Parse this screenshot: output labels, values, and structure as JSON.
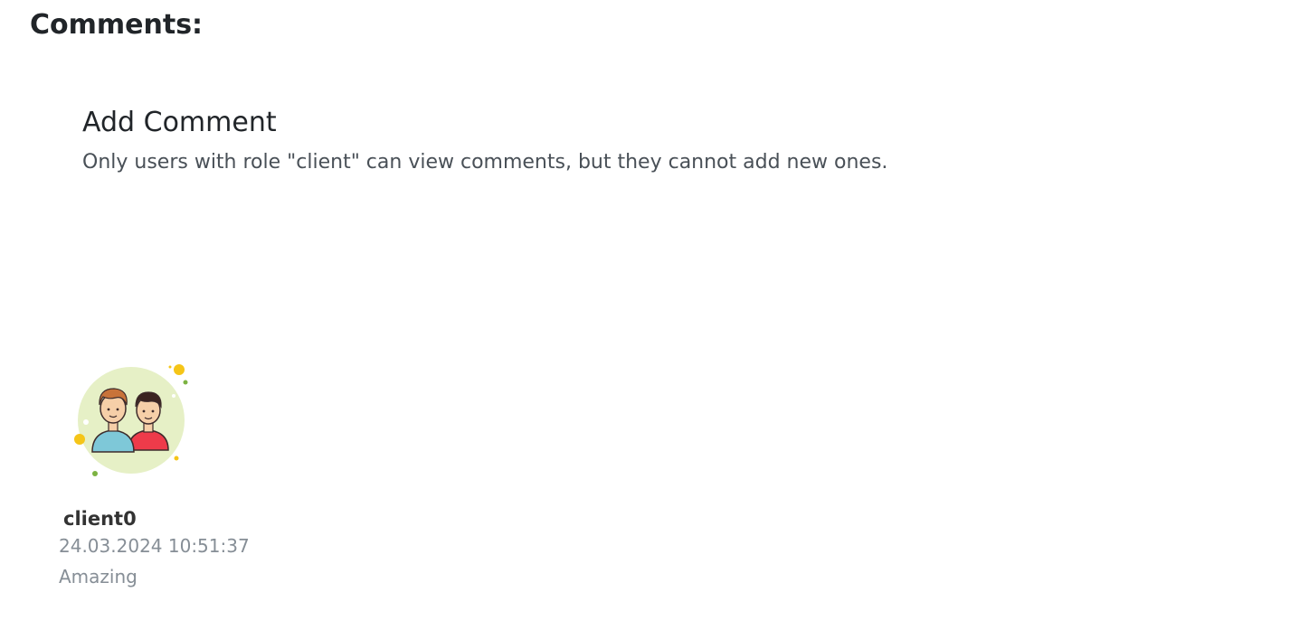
{
  "comments_section": {
    "title": "Comments:"
  },
  "add_comment": {
    "title": "Add Comment",
    "note": "Only users with role \"client\" can view comments, but they cannot add new ones."
  },
  "comments": [
    {
      "avatar_icon": "two-users-avatar-icon",
      "author": "client0",
      "date": "24.03.2024 10:51:37",
      "text": "Amazing"
    }
  ]
}
